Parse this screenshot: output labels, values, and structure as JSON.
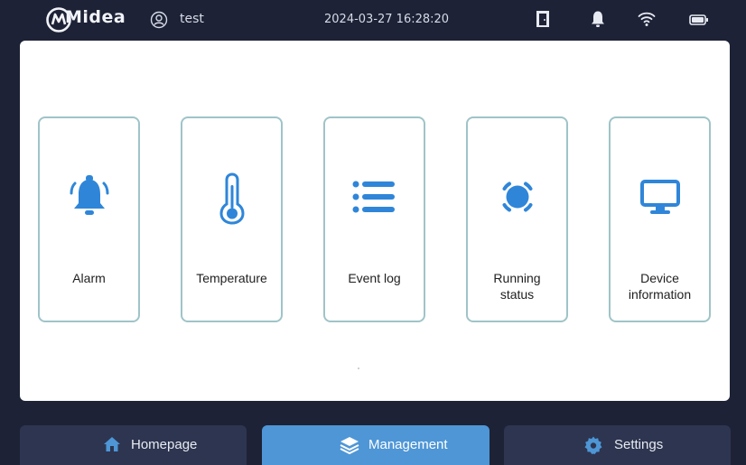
{
  "status_bar": {
    "brand": "Midea",
    "user_name": "test",
    "datetime": "2024-03-27 16:28:20",
    "icons": [
      "user-icon",
      "door-icon",
      "bell-icon",
      "wifi-icon",
      "battery-icon"
    ]
  },
  "cards": [
    {
      "label": "Alarm",
      "icon": "bell-icon"
    },
    {
      "label": "Temperature",
      "icon": "thermometer-icon"
    },
    {
      "label": "Event log",
      "icon": "list-icon"
    },
    {
      "label": "Running\nstatus",
      "icon": "running-status-icon"
    },
    {
      "label": "Device\ninformation",
      "icon": "monitor-icon"
    }
  ],
  "nav": {
    "tabs": [
      {
        "label": "Homepage",
        "icon": "home-icon",
        "active": false
      },
      {
        "label": "Management",
        "icon": "layers-icon",
        "active": true
      },
      {
        "label": "Settings",
        "icon": "gear-icon",
        "active": false
      }
    ]
  },
  "colors": {
    "background": "#1d2236",
    "panel": "#ffffff",
    "card_border": "#9fc4c8",
    "accent_blue": "#2f86d9",
    "active_tab": "#4e96d6",
    "inactive_tab": "#2d3550",
    "home_icon": "#4e96d6"
  }
}
